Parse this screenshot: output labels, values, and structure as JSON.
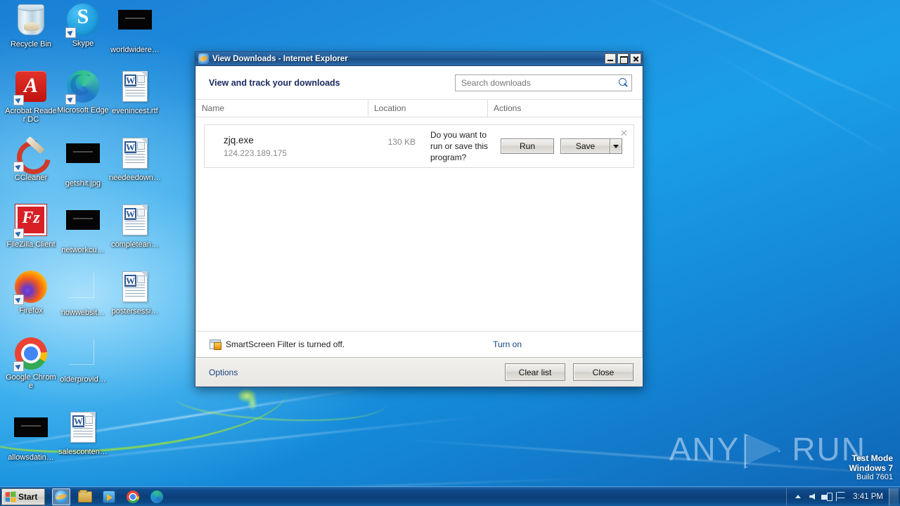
{
  "desktop": {
    "icons": [
      {
        "label": "Recycle Bin",
        "kind": "recycle",
        "shortcut": false,
        "col": 0,
        "row": 0
      },
      {
        "label": "Skype",
        "kind": "skype",
        "shortcut": true,
        "col": 1,
        "row": 0
      },
      {
        "label": "worldwidere…",
        "kind": "black",
        "shortcut": false,
        "col": 2,
        "row": 0
      },
      {
        "label": "Acrobat Reader DC",
        "kind": "acrobat",
        "shortcut": true,
        "col": 0,
        "row": 1
      },
      {
        "label": "Microsoft Edge",
        "kind": "edge",
        "shortcut": true,
        "col": 1,
        "row": 1
      },
      {
        "label": "evenincest.rtf",
        "kind": "doc",
        "shortcut": false,
        "col": 2,
        "row": 1
      },
      {
        "label": "CCleaner",
        "kind": "ccleaner",
        "shortcut": true,
        "col": 0,
        "row": 2
      },
      {
        "label": "getshit.jpg",
        "kind": "black",
        "shortcut": false,
        "col": 1,
        "row": 2
      },
      {
        "label": "needeedown…",
        "kind": "doc",
        "shortcut": false,
        "col": 2,
        "row": 2
      },
      {
        "label": "FileZilla Client",
        "kind": "filezilla",
        "shortcut": true,
        "col": 0,
        "row": 3
      },
      {
        "label": "networkcu…",
        "kind": "black",
        "shortcut": false,
        "col": 1,
        "row": 3
      },
      {
        "label": "completean…",
        "kind": "doc",
        "shortcut": false,
        "col": 2,
        "row": 3
      },
      {
        "label": "Firefox",
        "kind": "firefox",
        "shortcut": true,
        "col": 0,
        "row": 4
      },
      {
        "label": "nowwebsit…",
        "kind": "blank",
        "shortcut": false,
        "col": 1,
        "row": 4
      },
      {
        "label": "postersessi…",
        "kind": "doc",
        "shortcut": false,
        "col": 2,
        "row": 4
      },
      {
        "label": "Google Chrome",
        "kind": "chrome",
        "shortcut": true,
        "col": 0,
        "row": 5
      },
      {
        "label": "olderprovid…",
        "kind": "blank",
        "shortcut": false,
        "col": 1,
        "row": 5
      },
      {
        "label": "allowsdatin…",
        "kind": "black",
        "shortcut": false,
        "col": 0,
        "row": 6
      },
      {
        "label": "salesconten…",
        "kind": "doc",
        "shortcut": false,
        "col": 1,
        "row": 6
      }
    ],
    "watermark": {
      "text_left": "ANY",
      "text_right": "RUN",
      "icon": "play-triangle-icon"
    },
    "system_info": {
      "line1": "Test Mode",
      "line2": "Windows 7",
      "line3": "Build 7601"
    }
  },
  "ie_window": {
    "title": "View Downloads - Internet Explorer",
    "title_icon": "internet-explorer-icon",
    "window_buttons": {
      "minimize": "minimize-icon",
      "maximize": "maximize-icon",
      "close": "close-icon"
    },
    "header": {
      "heading": "View and track your downloads",
      "search_placeholder": "Search downloads",
      "search_value": "",
      "search_icon": "search-icon"
    },
    "columns": [
      "Name",
      "Location",
      "Actions"
    ],
    "downloads": [
      {
        "name": "zjq.exe",
        "size": "130 KB",
        "host": "124.223.189.175",
        "prompt": "Do you want to run or save this program?",
        "run_label": "Run",
        "save_label": "Save",
        "dropdown_icon": "chevron-down-icon",
        "dismiss_icon": "close-icon"
      }
    ],
    "smartscreen": {
      "icon": "smartscreen-shield-icon",
      "text": "SmartScreen Filter is turned off.",
      "action_label": "Turn on"
    },
    "footer": {
      "options_label": "Options",
      "clear_list_label": "Clear list",
      "close_label": "Close"
    }
  },
  "taskbar": {
    "start_label": "Start",
    "start_icon": "windows-flag-icon",
    "quick_launch": [
      {
        "name": "internet-explorer-icon",
        "kind": "ie",
        "active": true
      },
      {
        "name": "windows-explorer-icon",
        "kind": "explorer",
        "active": false
      },
      {
        "name": "media-player-icon",
        "kind": "media",
        "active": false
      },
      {
        "name": "google-chrome-icon",
        "kind": "chrome",
        "active": false
      },
      {
        "name": "microsoft-edge-icon",
        "kind": "edge",
        "active": false
      }
    ],
    "tray": [
      {
        "name": "show-hidden-icons-icon"
      },
      {
        "name": "volume-icon"
      },
      {
        "name": "network-icon"
      },
      {
        "name": "action-center-flag-icon"
      }
    ],
    "clock": "3:41 PM",
    "show_desktop": "show-desktop-button"
  },
  "colors": {
    "desktop_blue": "#1b8ede",
    "titlebar_blue": "#1f5894",
    "heading_navy": "#1b2a60",
    "link_blue": "#16417f"
  }
}
